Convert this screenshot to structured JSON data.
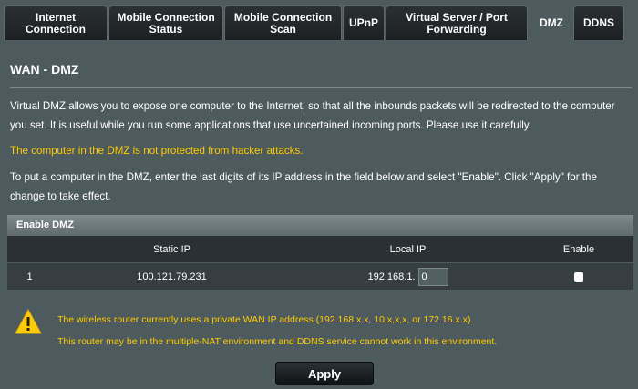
{
  "tabs": [
    {
      "label": "Internet\nConnection",
      "active": false
    },
    {
      "label": "Mobile Connection\nStatus",
      "active": false
    },
    {
      "label": "Mobile Connection\nScan",
      "active": false
    },
    {
      "label": "UPnP",
      "active": false
    },
    {
      "label": "Virtual Server / Port\nForwarding",
      "active": false
    },
    {
      "label": "DMZ",
      "active": true
    },
    {
      "label": "DDNS",
      "active": false
    }
  ],
  "page": {
    "title": "WAN - DMZ",
    "description": "Virtual DMZ allows you to expose one computer to the Internet, so that all the inbounds packets will be redirected to the computer you set. It is useful while you run some applications that use uncertained incoming ports. Please use it carefully.",
    "warning": "The computer in the DMZ is not protected from hacker attacks.",
    "instructions": "To put a computer in the DMZ, enter the last digits of its IP address in the field below and select \"Enable\". Click \"Apply\" for the change to take effect."
  },
  "dmz_table": {
    "header": "Enable DMZ",
    "columns": [
      "",
      "Static IP",
      "Local IP",
      "Enable"
    ],
    "rows": [
      {
        "index": "1",
        "static_ip": "100.121.79.231",
        "local_prefix": "192.168.1.",
        "local_suffix": "0",
        "enabled": false
      }
    ]
  },
  "notes": {
    "line1": "The wireless router currently uses a private WAN IP address (192.168.x.x, 10,x,x,x, or 172.16.x.x).",
    "line2": "This router may be in the multiple-NAT environment and DDNS service cannot work in this environment."
  },
  "apply_label": "Apply",
  "colors": {
    "background": "#4d5a5e",
    "warning": "#ffcc00",
    "tab_dark": "#1c2022"
  }
}
